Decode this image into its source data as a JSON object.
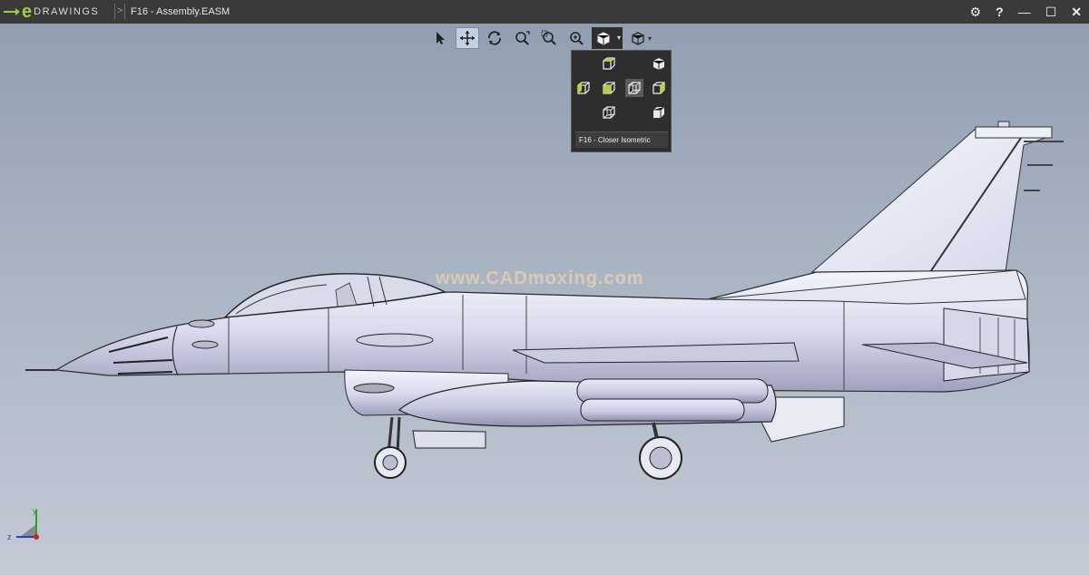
{
  "titlebar": {
    "brand": "DRAWINGS",
    "doc_title": "F16 - Assembly.EASM"
  },
  "toolbar": {
    "tools": [
      "select-icon",
      "pan-icon",
      "rotate-icon",
      "zoom-to-fit-icon",
      "zoom-to-area-icon",
      "zoom-icon",
      "views-icon",
      "display-style-icon"
    ],
    "active": "pan-icon"
  },
  "views_popup": {
    "selected_view": "F16 - Closer Isometric"
  },
  "watermark": "www.CADmoxing.com",
  "triad": {
    "x_label": "z",
    "y_label": "y"
  },
  "colors": {
    "accent": "#9ccf3c",
    "titlebar": "#3a3a3a",
    "popup_bg": "#2e2e2e",
    "face_green": "#b5d334"
  }
}
